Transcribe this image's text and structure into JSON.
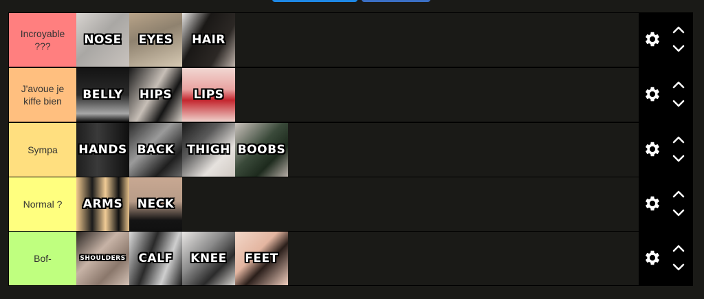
{
  "colors": {
    "accent_blue": "#1e88e5",
    "accent_dark_blue": "#3b6fc4",
    "background": "#1a1a17"
  },
  "tiers": [
    {
      "label": "Incroyable ???",
      "color": "#ff7f7f",
      "items": [
        {
          "text": "NOSE",
          "bg": "linear-gradient(135deg,#d8d4d0 0%,#a9a7a4 45%,#c9c3be 100%)"
        },
        {
          "text": "EYES",
          "bg": "linear-gradient(160deg,#b9a489 0%,#8f826f 40%,#d6c9b3 100%)"
        },
        {
          "text": "HAIR",
          "bg": "linear-gradient(120deg,#e8e6e4 0%,#1a1816 35%,#2c2825 70%,#bfb3ab 100%)"
        }
      ]
    },
    {
      "label": "J'avoue je kiffe bien",
      "color": "#ffbf7f",
      "items": [
        {
          "text": "BELLY",
          "bg": "linear-gradient(180deg,#141414 0%,#2a2a2a 50%,#a7a7a7 85%,#111 100%)"
        },
        {
          "text": "HIPS",
          "bg": "linear-gradient(120deg,#1b1b1b 0%,#c7bfb7 45%,#151515 70%,#d8d0c8 100%)"
        },
        {
          "text": "LIPS",
          "bg": "linear-gradient(180deg,#f1d7d2 0%,#e9a3a1 40%,#c4262e 60%,#efd1cb 100%)"
        }
      ]
    },
    {
      "label": "Sympa",
      "color": "#ffdf7f",
      "items": [
        {
          "text": "HANDS",
          "bg": "linear-gradient(90deg,#1e1e1e 0%,#3a3a3a 40%,#0f0f0f 100%)"
        },
        {
          "text": "BACK",
          "bg": "linear-gradient(135deg,#2b2b2b 0%,#9b9b9b 40%,#1e1e1e 75%,#6a6a6a 100%)"
        },
        {
          "text": "THIGH",
          "bg": "linear-gradient(135deg,#1a1a1a 0%,#5a5a5a 35%,#e6e2de 70%,#cfc8c2 100%)"
        },
        {
          "text": "BOOBS",
          "bg": "linear-gradient(135deg,#c9c1bb 0%,#3a4a3a 45%,#1d2a1d 70%,#b6ada6 100%)"
        }
      ]
    },
    {
      "label": "Normal ?",
      "color": "#ffff7f",
      "items": [
        {
          "text": "ARMS",
          "bg": "linear-gradient(90deg,#f0c98e 0%,#1b1b1b 30%,#f0cb95 55%,#111 80%,#e9c38b 100%)"
        },
        {
          "text": "NECK",
          "bg": "linear-gradient(180deg,#c8a892 0%,#b89c88 45%,#141414 80%,#101010 100%)"
        }
      ]
    },
    {
      "label": "Bof-",
      "color": "#bfff7f",
      "items": [
        {
          "text": "SHOULDERS",
          "bg": "linear-gradient(135deg,#2a2522 0%,#c7b3a6 40%,#8a776b 70%,#d4c2b6 100%)",
          "small": true
        },
        {
          "text": "CALF",
          "bg": "linear-gradient(110deg,#dcdcdc 0%,#2a2a2a 40%,#cfcfcf 70%,#1a1a1a 100%)"
        },
        {
          "text": "KNEE",
          "bg": "linear-gradient(135deg,#e8e6e4 0%,#8b8b8b 40%,#2b2b2b 70%,#d9d6d2 100%)"
        },
        {
          "text": "FEET",
          "bg": "linear-gradient(135deg,#f3d7c8 0%,#e3b5a0 40%,#2a1e1a 60%,#f2cfbf 100%)"
        }
      ]
    }
  ],
  "icons": {
    "settings": "gear-icon",
    "move_up": "chevron-up-icon",
    "move_down": "chevron-down-icon"
  }
}
